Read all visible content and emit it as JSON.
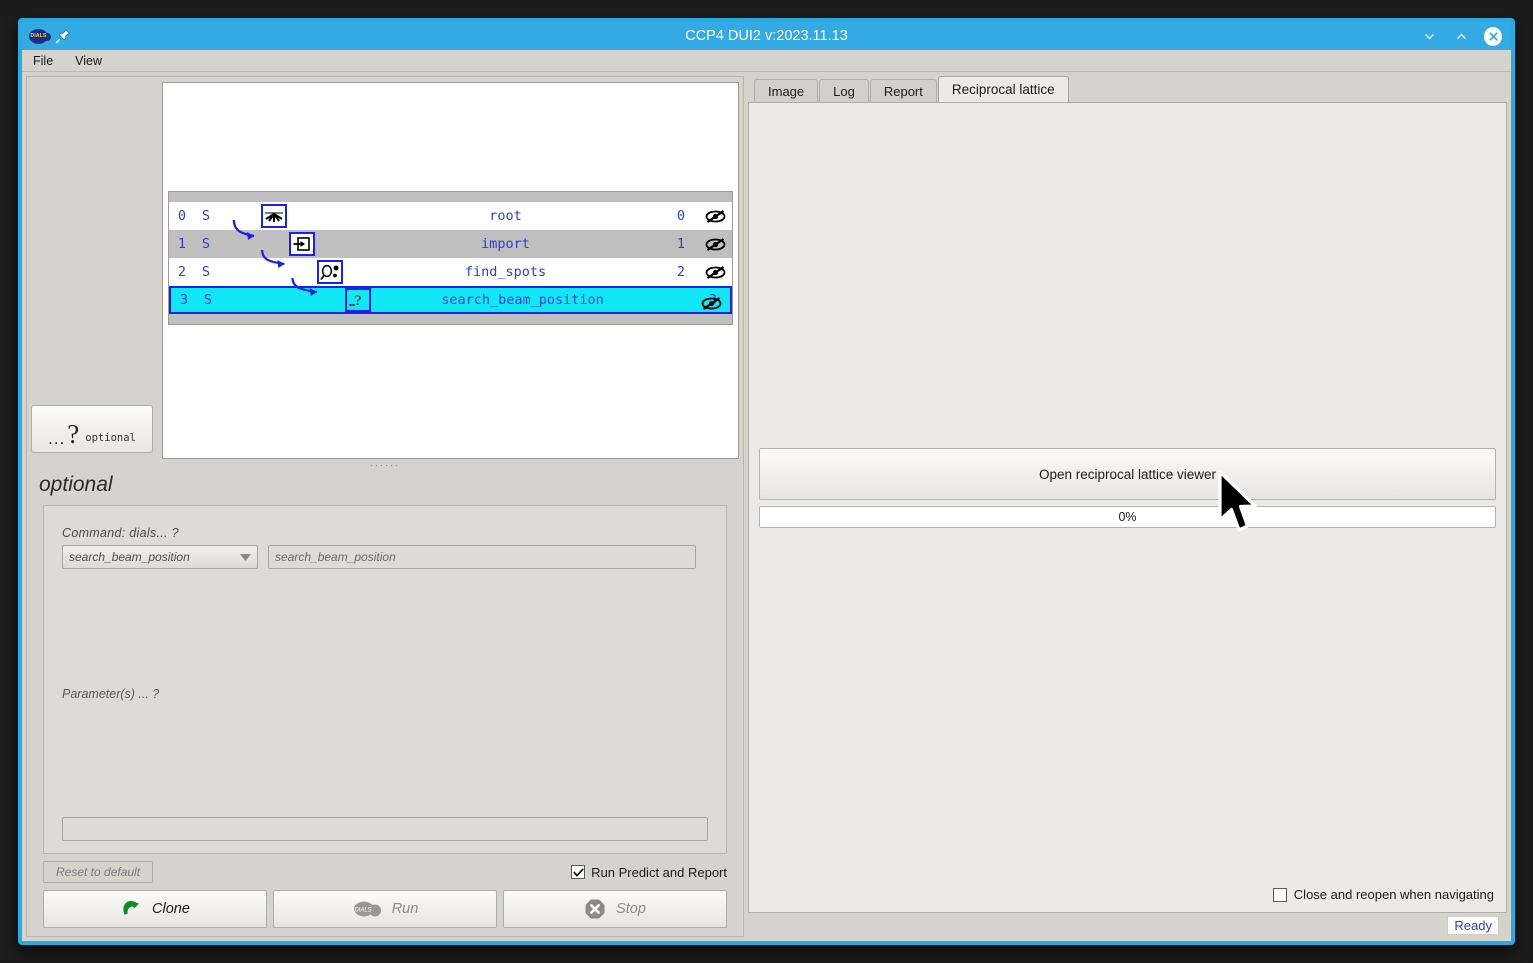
{
  "window": {
    "title": "CCP4 DUI2 v:2023.11.13",
    "logo_icon": "dials-logo-icon",
    "pin_icon": "pin-icon",
    "minimize_icon": "chevron-down-icon",
    "maximize_icon": "chevron-up-icon",
    "close_icon": "close-icon",
    "titlebar_color": "#33aae4",
    "border_color": "#29abe2"
  },
  "menubar": {
    "items": [
      {
        "label": "File"
      },
      {
        "label": "View"
      }
    ]
  },
  "node_palette": {
    "optional_button": {
      "dots": "...",
      "question": "?",
      "label": "optional",
      "icon": "question-mark-icon"
    }
  },
  "tree": {
    "rows": [
      {
        "index": "0",
        "status": "S",
        "name": "root",
        "number": "0",
        "icon": "root-node-icon",
        "eye_icon": "eye-hidden-icon",
        "bg": "white",
        "selected": false
      },
      {
        "index": "1",
        "status": "S",
        "name": "import",
        "number": "1",
        "icon": "import-node-icon",
        "eye_icon": "eye-hidden-icon",
        "bg": "grey",
        "selected": false
      },
      {
        "index": "2",
        "status": "S",
        "name": "find_spots",
        "number": "2",
        "icon": "findspots-node-icon",
        "eye_icon": "eye-hidden-icon",
        "bg": "white",
        "selected": false
      },
      {
        "index": "3",
        "status": "S",
        "name": "search_beam_position",
        "number": "3",
        "icon": "question-node-icon",
        "eye_icon": "eye-hidden-icon",
        "bg": "selected",
        "selected": true
      }
    ],
    "selection_color": "#12e8f5",
    "node_link_color": "#1a20ee",
    "text_color": "#2a3fd8"
  },
  "params": {
    "header": "optional",
    "command_label": "Command:  dials...  ?",
    "command_select_value": "search_beam_position",
    "command_select_chevron": "chevron-down-icon",
    "command_input_value": "search_beam_position",
    "parameters_label": "Parameter(s) ... ?",
    "free_input_value": ""
  },
  "actions": {
    "reset_label": "Reset to default",
    "predict_checkbox_label": "Run Predict and Report",
    "predict_checked": true,
    "buttons": [
      {
        "label": "Clone",
        "icon": "clone-arrow-icon",
        "enabled": true
      },
      {
        "label": "Run",
        "icon": "dials-run-icon",
        "enabled": false
      },
      {
        "label": "Stop",
        "icon": "stop-octagon-icon",
        "enabled": false
      }
    ]
  },
  "right_panel": {
    "tabs": [
      {
        "label": "Image",
        "active": false
      },
      {
        "label": "Log",
        "active": false
      },
      {
        "label": "Report",
        "active": false
      },
      {
        "label": "Reciprocal lattice",
        "active": true
      }
    ],
    "open_viewer_button": "Open reciprocal lattice viewer",
    "progress_text": "0%",
    "progress_value": 0,
    "reopen_checkbox_label": "Close and reopen when navigating",
    "reopen_checked": false
  },
  "statusbar": {
    "status": "Ready",
    "status_color": "#2a3fd8"
  },
  "cursor": {
    "icon": "mouse-pointer-icon"
  }
}
